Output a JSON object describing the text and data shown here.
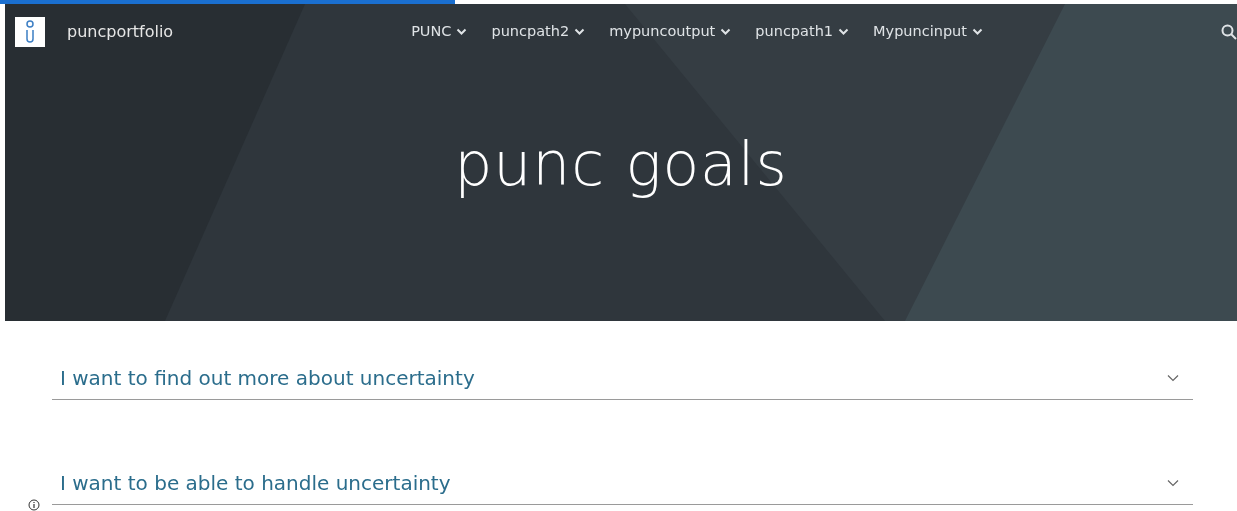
{
  "site": {
    "title": "puncportfolio"
  },
  "nav": [
    {
      "label": "PUNC"
    },
    {
      "label": "puncpath2"
    },
    {
      "label": "mypuncoutput"
    },
    {
      "label": "puncpath1"
    },
    {
      "label": "Mypuncinput"
    }
  ],
  "hero": {
    "title": "punc goals"
  },
  "accordion": [
    {
      "title": "I want to find out more about uncertainty",
      "expanded": false
    },
    {
      "title": "I want to be able to handle uncertainty",
      "expanded": false
    }
  ]
}
